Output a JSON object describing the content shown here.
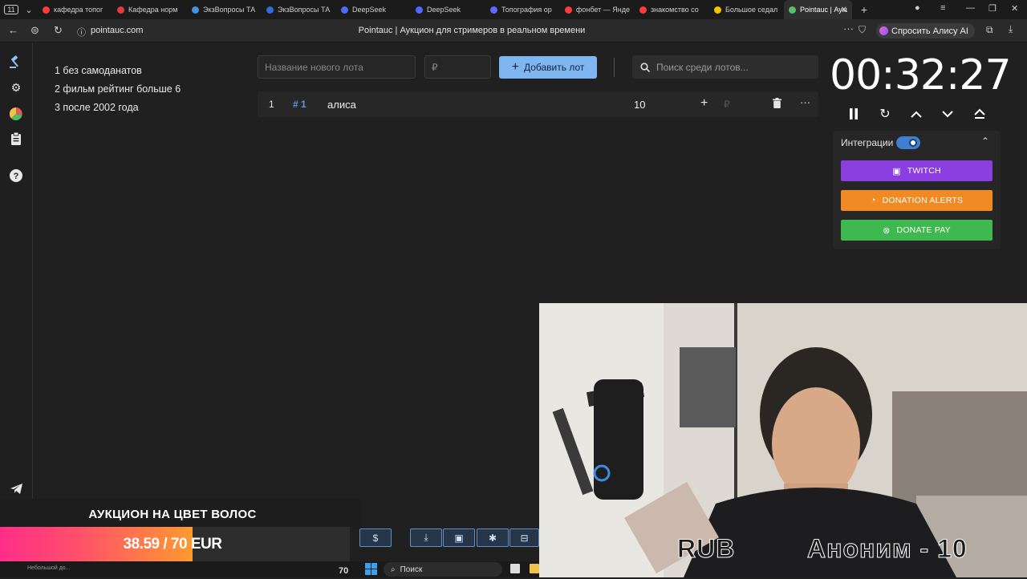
{
  "browser": {
    "tabs": [
      {
        "label": "кафедра топог",
        "color": "#ff3b3b"
      },
      {
        "label": "Кафедра норм",
        "color": "#e23c3c"
      },
      {
        "label": "ЭкзВопросы ТА",
        "color": "#4a90e2"
      },
      {
        "label": "ЭкзВопросы ТА",
        "color": "#2d6fd6"
      },
      {
        "label": "DeepSeek",
        "color": "#4d6bfe"
      },
      {
        "label": "DeepSeek",
        "color": "#4d6bfe"
      },
      {
        "label": "Топография ор",
        "color": "#5b6cff"
      },
      {
        "label": "фонбет — Янде",
        "color": "#ff3b3b"
      },
      {
        "label": "знакомство со",
        "color": "#ff3b3b"
      },
      {
        "label": "Большое седал",
        "color": "#f6c200"
      },
      {
        "label": "Pointauc | Аукц",
        "color": "#57c16b",
        "active": true
      }
    ],
    "url": "pointauc.com",
    "page_title": "Pointauc | Аукцион для стримеров в реальном времени",
    "alisa_button": "Спросить Алису AI"
  },
  "rules": [
    "1 без самоданатов",
    "2 фильм рейтинг больше 6",
    "3 после 2002 года"
  ],
  "toolbar": {
    "new_lot_placeholder": "Название нового лота",
    "amount_placeholder": "₽",
    "add_lot_label": "Добавить лот",
    "search_placeholder": "Поиск среди лотов..."
  },
  "lots": [
    {
      "rank": "1",
      "id": "# 1",
      "name": "алиса",
      "amount": "10",
      "currency": "₽"
    }
  ],
  "timer": {
    "value": "00:32:27"
  },
  "integrations": {
    "label": "Интеграции",
    "enabled": true,
    "buttons": [
      {
        "label": "TWITCH",
        "color": "#8a3ee0"
      },
      {
        "label": "DONATION ALERTS",
        "color": "#f18a23"
      },
      {
        "label": "DONATE PAY",
        "color": "#3fb94f"
      }
    ]
  },
  "overlay": {
    "title": "АУКЦИОН НА ЦВЕТ ВОЛОС",
    "progress_text": "38.59 / 70 EUR",
    "progress_fraction": 0.5513,
    "footer_left": "Небольшой до...",
    "footer_right": "70"
  },
  "taskbar": {
    "search_label": "Поиск"
  },
  "webcam": {
    "ticker_left": "RUB",
    "ticker_right": "Аноним - 10"
  }
}
